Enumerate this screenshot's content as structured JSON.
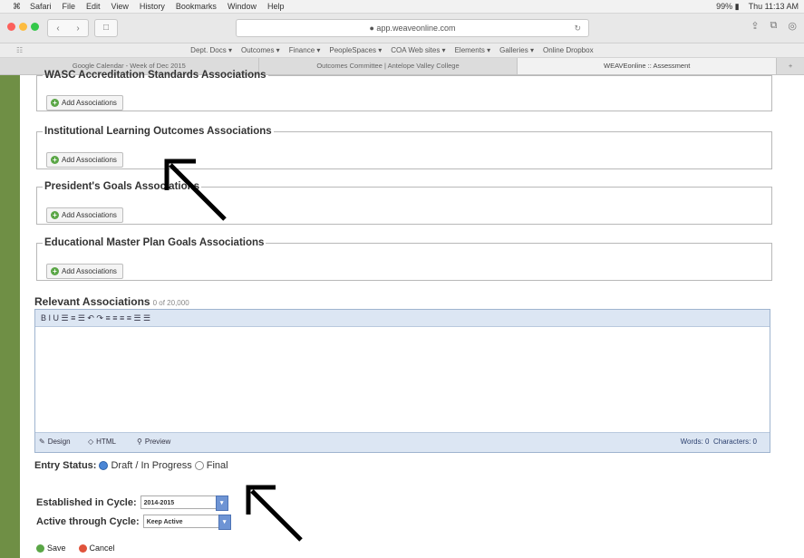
{
  "menubar": {
    "apple": "⌘",
    "items": [
      "Safari",
      "File",
      "Edit",
      "View",
      "History",
      "Bookmarks",
      "Window",
      "Help"
    ],
    "status": [
      "99% ▮",
      "Thu 11:13 AM"
    ]
  },
  "browser": {
    "url": "● app.weaveonline.com",
    "tabs": [
      "Google Calendar - Week of Dec 2015",
      "Outcomes Committee | Antelope Valley College",
      "WEAVEonline :: Assessment"
    ]
  },
  "bookmarks": [
    "Dept. Docs ▾",
    "Outcomes ▾",
    "Finance ▾",
    "PeopleSpaces ▾",
    "COA Web sites ▾",
    "Elements ▾",
    "Galleries ▾",
    "Online Dropbox"
  ],
  "sections": [
    {
      "legend": "WASC Accreditation Standards Associations",
      "button": "Add Associations"
    },
    {
      "legend": "Institutional Learning Outcomes Associations",
      "button": "Add Associations"
    },
    {
      "legend": "President's Goals Associations",
      "button": "Add Associations"
    },
    {
      "legend": "Educational Master Plan Goals Associations",
      "button": "Add Associations"
    }
  ],
  "relevant": {
    "label": "Relevant Associations",
    "count": "0 of 20,000",
    "toolbar_icons": "B  I  U   ☰  ≡  ☰   ↶  ↷   ≡  ≡  ≡  ≡  ☰  ☰",
    "modes": [
      "Design",
      "HTML",
      "Preview"
    ],
    "words_label": "Words: 0",
    "chars_label": "Characters: 0"
  },
  "entry_status": {
    "label": "Entry Status:",
    "options": [
      "Draft / In Progress",
      "Final"
    ],
    "selected": "Draft / In Progress"
  },
  "cycle": {
    "established_label": "Established in Cycle:",
    "established_value": "2014-2015",
    "active_label": "Active through Cycle:",
    "active_value": "Keep Active"
  },
  "actions": {
    "save": "Save",
    "cancel": "Cancel"
  },
  "colors": {
    "accent_green": "#5aa646",
    "editor_blue": "#dce6f3",
    "gutter_green": "#6f8f45"
  }
}
